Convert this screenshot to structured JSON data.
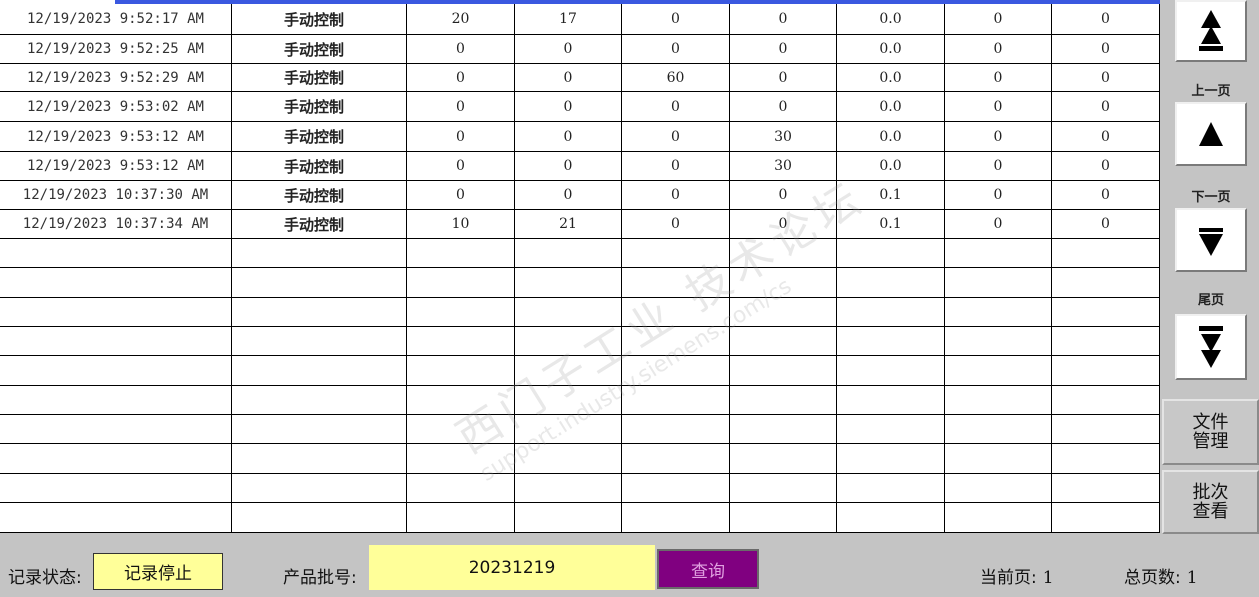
{
  "table": {
    "rows": [
      {
        "time": "12/19/2023 9:52:17 AM",
        "mode": "手动控制",
        "c1": "20",
        "c2": "17",
        "c3": "0",
        "c4": "0",
        "c5": "0.0",
        "c6": "0",
        "c7": "0"
      },
      {
        "time": "12/19/2023 9:52:25 AM",
        "mode": "手动控制",
        "c1": "0",
        "c2": "0",
        "c3": "0",
        "c4": "0",
        "c5": "0.0",
        "c6": "0",
        "c7": "0"
      },
      {
        "time": "12/19/2023 9:52:29 AM",
        "mode": "手动控制",
        "c1": "0",
        "c2": "0",
        "c3": "60",
        "c4": "0",
        "c5": "0.0",
        "c6": "0",
        "c7": "0"
      },
      {
        "time": "12/19/2023 9:53:02 AM",
        "mode": "手动控制",
        "c1": "0",
        "c2": "0",
        "c3": "0",
        "c4": "0",
        "c5": "0.0",
        "c6": "0",
        "c7": "0"
      },
      {
        "time": "12/19/2023 9:53:12 AM",
        "mode": "手动控制",
        "c1": "0",
        "c2": "0",
        "c3": "0",
        "c4": "30",
        "c5": "0.0",
        "c6": "0",
        "c7": "0"
      },
      {
        "time": "12/19/2023 9:53:12 AM",
        "mode": "手动控制",
        "c1": "0",
        "c2": "0",
        "c3": "0",
        "c4": "30",
        "c5": "0.0",
        "c6": "0",
        "c7": "0"
      },
      {
        "time": "12/19/2023 10:37:30 AM",
        "mode": "手动控制",
        "c1": "0",
        "c2": "0",
        "c3": "0",
        "c4": "0",
        "c5": "0.1",
        "c6": "0",
        "c7": "0"
      },
      {
        "time": "12/19/2023 10:37:34 AM",
        "mode": "手动控制",
        "c1": "10",
        "c2": "21",
        "c3": "0",
        "c4": "0",
        "c5": "0.1",
        "c6": "0",
        "c7": "0"
      }
    ]
  },
  "nav": {
    "first_icon": "double-up-arrow-icon",
    "prev_label": "上一页",
    "next_label": "下一页",
    "last_label": "尾页"
  },
  "side_buttons": {
    "file_manage": "文件管理",
    "batch_view": "批次查看"
  },
  "footer": {
    "record_status_label": "记录状态:",
    "record_status_value": "记录停止",
    "batch_label": "产品批号:",
    "batch_value": "20231219",
    "query_label": "查询",
    "current_page_label": "当前页:",
    "current_page_value": "1",
    "total_pages_label": "总页数:",
    "total_pages_value": "1"
  },
  "watermark": {
    "line1": "西门子工业 技术论坛",
    "line2": "support.industry.siemens.com/cs"
  },
  "colors": {
    "field_bg": "#ffff99",
    "query_bg": "#800080",
    "header_strip": "#3a58e0"
  }
}
